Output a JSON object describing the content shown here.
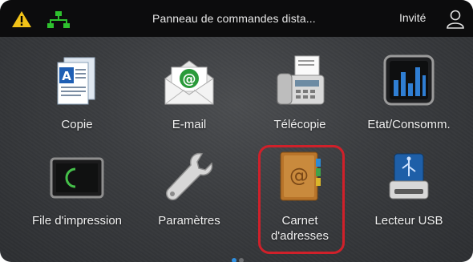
{
  "header": {
    "title": "Panneau de commandes dista...",
    "user_label": "Invité"
  },
  "apps": [
    {
      "label": "Copie",
      "icon": "copy-icon"
    },
    {
      "label": "E-mail",
      "icon": "email-icon"
    },
    {
      "label": "Télécopie",
      "icon": "fax-icon"
    },
    {
      "label": "Etat/Consomm.",
      "icon": "status-supplies-icon"
    },
    {
      "label": "File d'impression",
      "icon": "print-queue-icon"
    },
    {
      "label": "Paramètres",
      "icon": "settings-wrench-icon"
    },
    {
      "label": "Carnet\nd'adresses",
      "icon": "address-book-icon"
    },
    {
      "label": "Lecteur USB",
      "icon": "usb-drive-icon"
    }
  ],
  "pager": {
    "pages": 2,
    "current": 1
  },
  "colors": {
    "highlight": "#d0202a",
    "warning": "#f2c318",
    "network": "#2ec12e"
  }
}
